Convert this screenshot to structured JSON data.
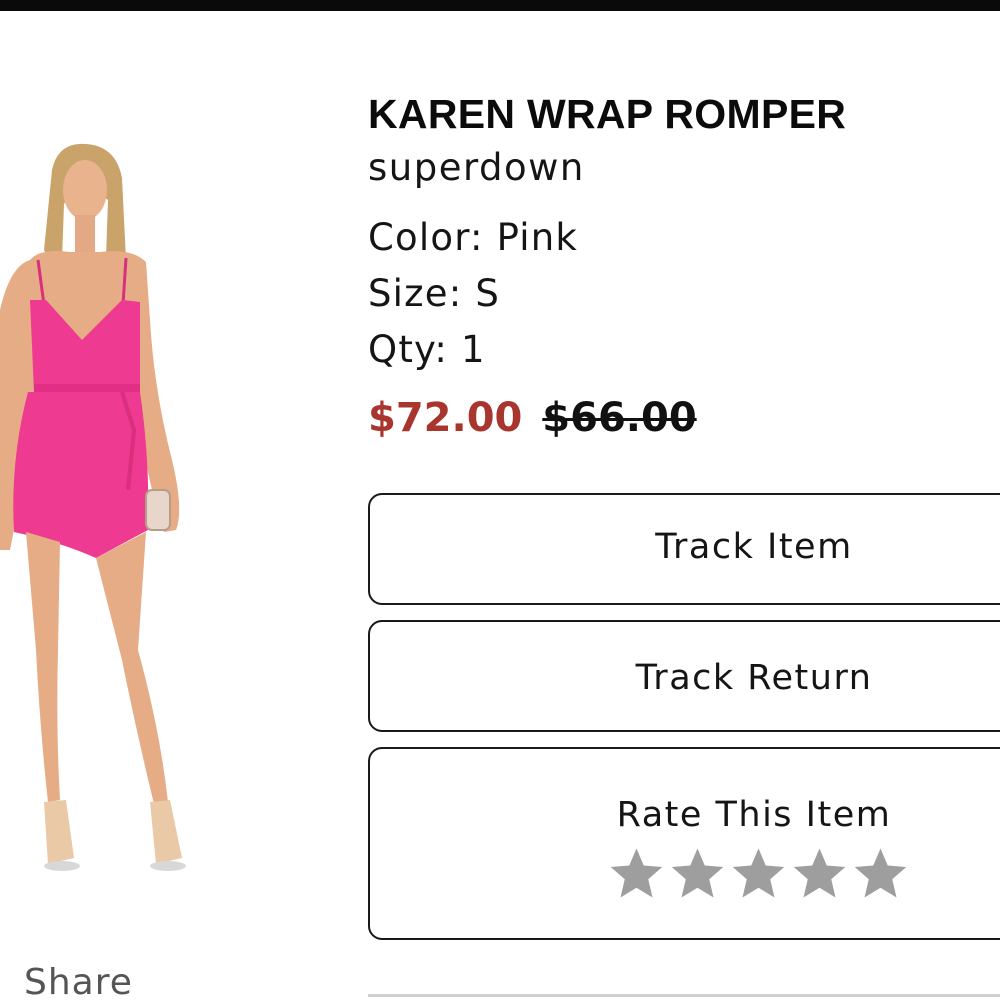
{
  "product": {
    "title": "KAREN WRAP ROMPER",
    "brand": "superdown",
    "color_text": "Color: Pink",
    "size_text": "Size: S",
    "qty_text": "Qty: 1",
    "price_sale": "$72.00",
    "price_original": "$66.00",
    "image_alt": "Model wearing pink wrap romper"
  },
  "actions": {
    "track_item_label": "Track Item",
    "track_return_label": "Track Return",
    "rate_label": "Rate This Item"
  },
  "rating": {
    "max_stars": 5,
    "value": 0,
    "star_color": "#9e9e9e"
  },
  "share": {
    "label": "Share"
  },
  "colors": {
    "sale_price": "#a8352e",
    "romper": "#ee3a90",
    "top_bar": "#0a0a0a"
  }
}
